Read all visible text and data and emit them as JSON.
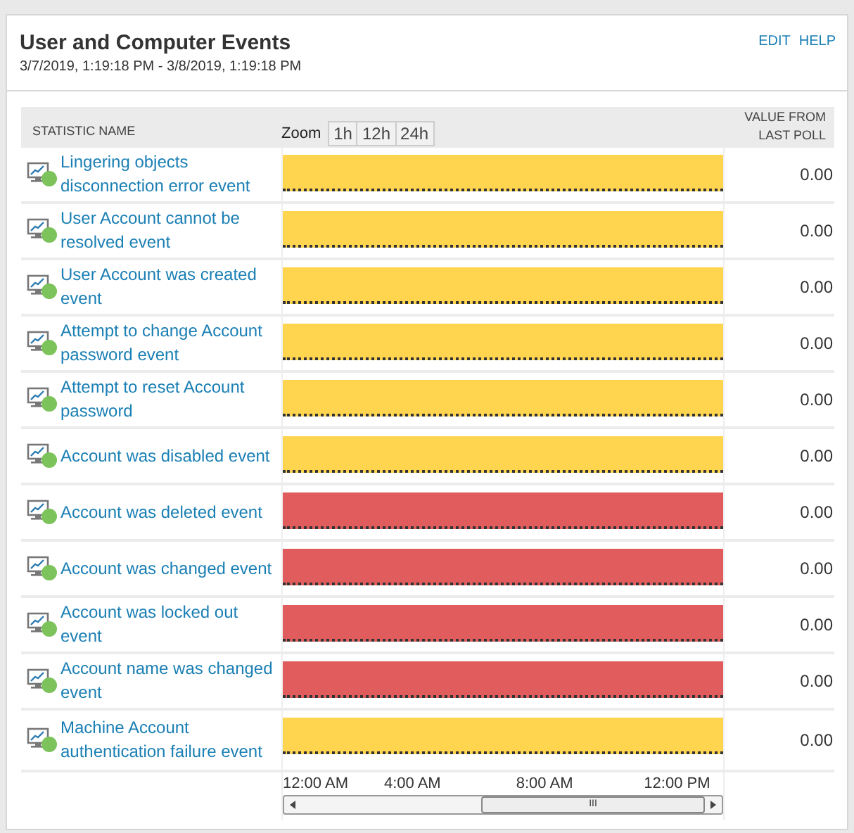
{
  "panel": {
    "title": "User and Computer Events",
    "subtitle": "3/7/2019, 1:19:18 PM - 3/8/2019, 1:19:18 PM",
    "actions": [
      "EDIT",
      "HELP"
    ]
  },
  "table": {
    "columns": [
      "STATISTIC NAME",
      "VALUE FROM LAST POLL"
    ],
    "zoom_label": "Zoom",
    "zoom_buttons": [
      "1h",
      "12h",
      "24h"
    ],
    "rows": [
      {
        "name": "Lingering objects disconnection error event",
        "value": "0.00",
        "color": "#ffd550"
      },
      {
        "name": "User Account cannot be resolved event",
        "value": "0.00",
        "color": "#ffd550"
      },
      {
        "name": "User Account was created event",
        "value": "0.00",
        "color": "#ffd550"
      },
      {
        "name": "Attempt to change Account password event",
        "value": "0.00",
        "color": "#ffd550"
      },
      {
        "name": "Attempt to reset Account password",
        "value": "0.00",
        "color": "#ffd550"
      },
      {
        "name": "Account was disabled event",
        "value": "0.00",
        "color": "#ffd550"
      },
      {
        "name": "Account was deleted event",
        "value": "0.00",
        "color": "#e15d5d"
      },
      {
        "name": "Account was changed event",
        "value": "0.00",
        "color": "#e15d5d"
      },
      {
        "name": "Account was locked out event",
        "value": "0.00",
        "color": "#e15d5d"
      },
      {
        "name": "Account name was changed event",
        "value": "0.00",
        "color": "#e15d5d"
      },
      {
        "name": "Machine Account authentication failure event",
        "value": "0.00",
        "color": "#ffd550"
      }
    ],
    "axis_labels": [
      "12:00 AM",
      "4:00 AM",
      "8:00 AM",
      "12:00 PM"
    ],
    "scrollbar": {
      "grip": "III"
    }
  }
}
